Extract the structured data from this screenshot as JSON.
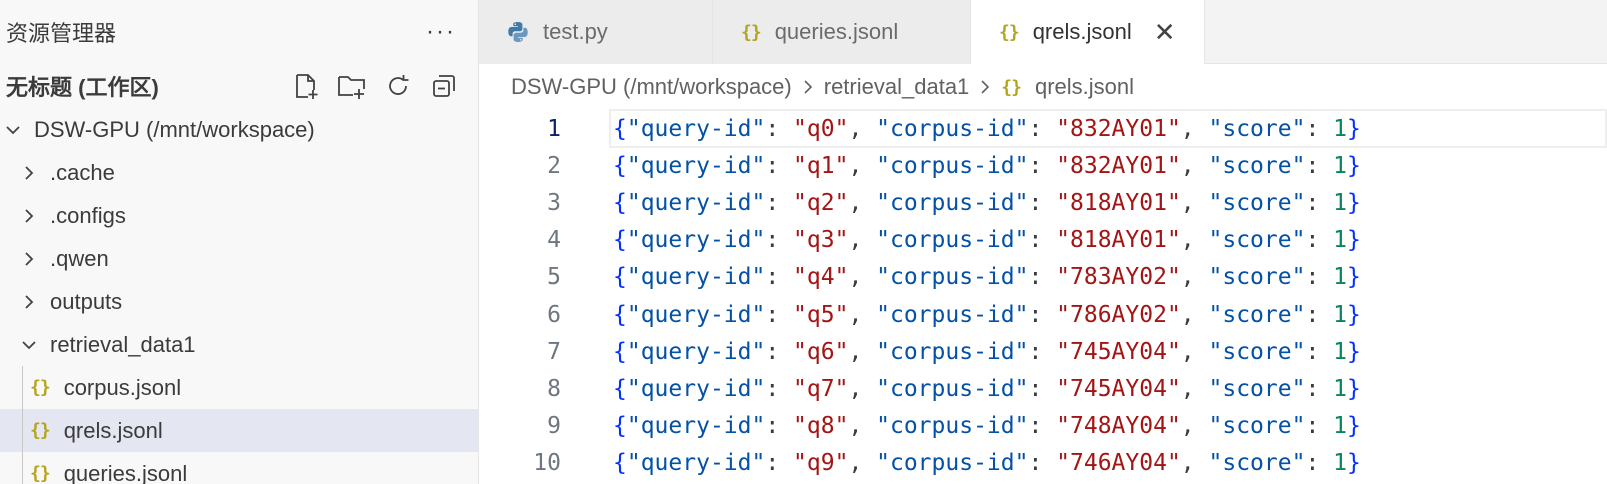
{
  "explorer": {
    "title": "资源管理器",
    "more": "···",
    "workspace_title": "无标题 (工作区)",
    "root_label": "DSW-GPU (/mnt/workspace)",
    "items": [
      {
        "label": ".cache"
      },
      {
        "label": ".configs"
      },
      {
        "label": ".qwen"
      },
      {
        "label": "outputs"
      },
      {
        "label": "retrieval_data1"
      }
    ],
    "files": [
      {
        "label": "corpus.jsonl"
      },
      {
        "label": "qrels.jsonl"
      },
      {
        "label": "queries.jsonl"
      }
    ]
  },
  "tabs": [
    {
      "label": "test.py",
      "icon": "python-icon"
    },
    {
      "label": "queries.jsonl",
      "icon": "json-icon"
    },
    {
      "label": "qrels.jsonl",
      "icon": "json-icon",
      "close": "✕"
    }
  ],
  "json_glyph": "{}",
  "breadcrumb": [
    "DSW-GPU (/mnt/workspace)",
    "retrieval_data1",
    "qrels.jsonl"
  ],
  "code": {
    "keys": {
      "query": "\"query-id\"",
      "corpus": "\"corpus-id\"",
      "score": "\"score\""
    },
    "lines": [
      {
        "num": "1",
        "query_id": "\"q0\"",
        "corpus_id": "\"832AY01\"",
        "score": "1"
      },
      {
        "num": "2",
        "query_id": "\"q1\"",
        "corpus_id": "\"832AY01\"",
        "score": "1"
      },
      {
        "num": "3",
        "query_id": "\"q2\"",
        "corpus_id": "\"818AY01\"",
        "score": "1"
      },
      {
        "num": "4",
        "query_id": "\"q3\"",
        "corpus_id": "\"818AY01\"",
        "score": "1"
      },
      {
        "num": "5",
        "query_id": "\"q4\"",
        "corpus_id": "\"783AY02\"",
        "score": "1"
      },
      {
        "num": "6",
        "query_id": "\"q5\"",
        "corpus_id": "\"786AY02\"",
        "score": "1"
      },
      {
        "num": "7",
        "query_id": "\"q6\"",
        "corpus_id": "\"745AY04\"",
        "score": "1"
      },
      {
        "num": "8",
        "query_id": "\"q7\"",
        "corpus_id": "\"745AY04\"",
        "score": "1"
      },
      {
        "num": "9",
        "query_id": "\"q8\"",
        "corpus_id": "\"748AY04\"",
        "score": "1"
      },
      {
        "num": "10",
        "query_id": "\"q9\"",
        "corpus_id": "\"746AY04\"",
        "score": "1"
      }
    ]
  }
}
